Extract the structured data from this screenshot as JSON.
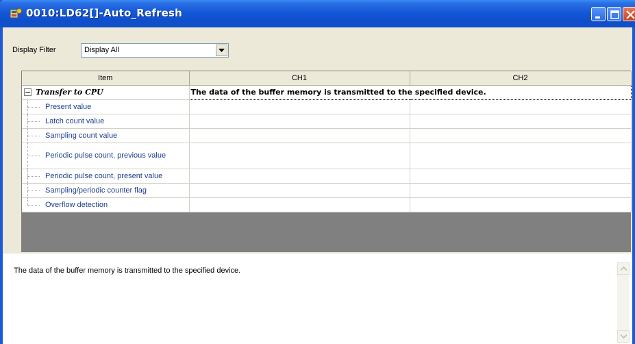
{
  "window": {
    "title": "0010:LD62[]-Auto_Refresh"
  },
  "filter": {
    "label": "Display Filter",
    "selected": "Display All"
  },
  "grid": {
    "columns": [
      "Item",
      "CH1",
      "CH2"
    ],
    "group": {
      "label": "Transfer to CPU",
      "description": "The data of the buffer memory is transmitted to the specified device."
    },
    "rows": [
      {
        "label": "Present value",
        "ch1": "",
        "ch2": ""
      },
      {
        "label": "Latch count value",
        "ch1": "",
        "ch2": ""
      },
      {
        "label": "Sampling count value",
        "ch1": "",
        "ch2": ""
      },
      {
        "label": "Periodic pulse count, previous value",
        "ch1": "",
        "ch2": ""
      },
      {
        "label": "Periodic pulse count, present value",
        "ch1": "",
        "ch2": ""
      },
      {
        "label": "Sampling/periodic counter flag",
        "ch1": "",
        "ch2": ""
      },
      {
        "label": "Overflow detection",
        "ch1": "",
        "ch2": ""
      }
    ]
  },
  "description": {
    "text": "The data of the buffer memory is transmitted to the specified device."
  },
  "icons": {
    "app": "app-icon",
    "minimize": "minimize-icon",
    "maximize": "maximize-icon",
    "close": "close-icon",
    "dropdown": "chevron-down-icon",
    "collapse": "minus-icon"
  }
}
